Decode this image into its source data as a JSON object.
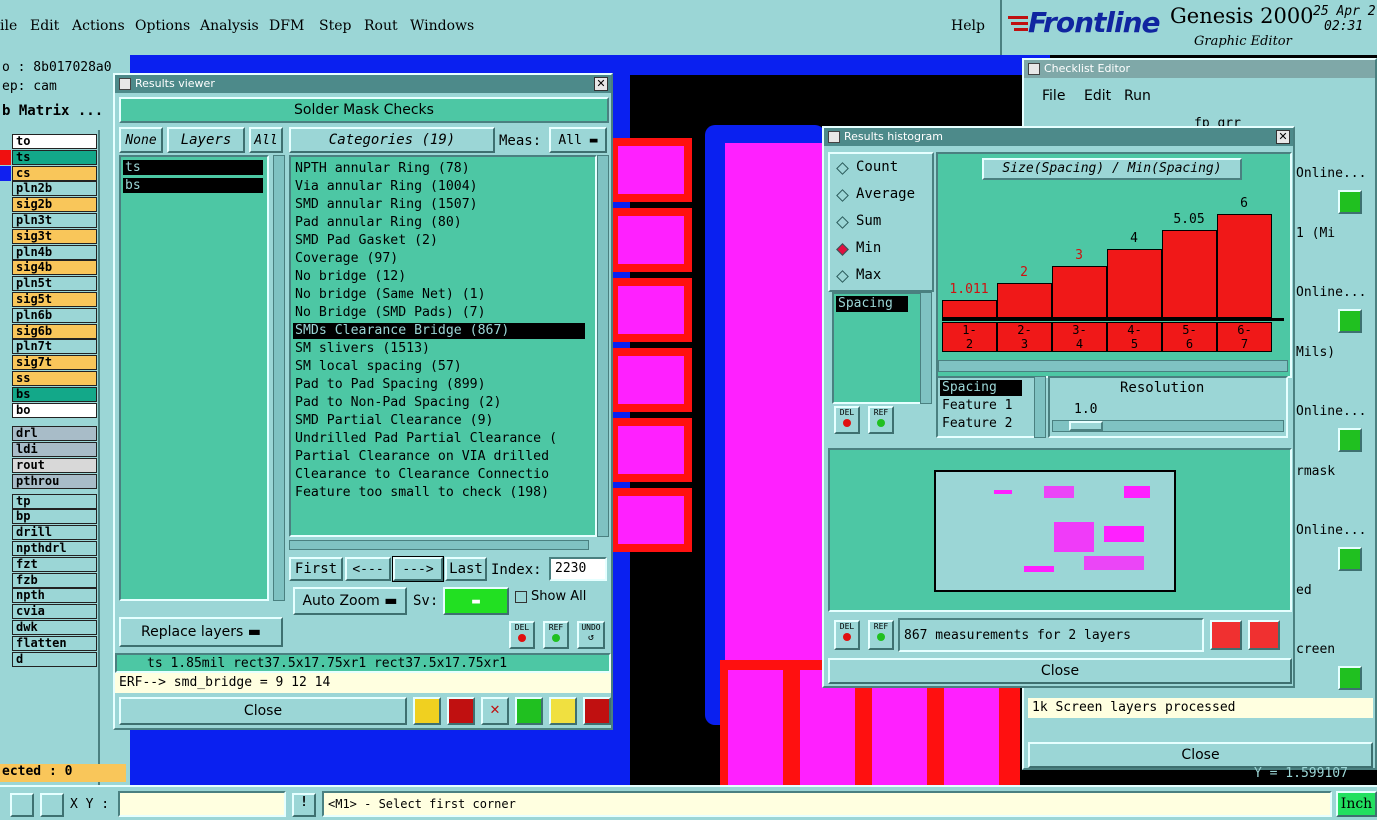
{
  "menubar": {
    "items": [
      "ile",
      "Edit",
      "Actions",
      "Options",
      "Analysis",
      "DFM",
      "Step",
      "Rout",
      "Windows"
    ],
    "help": "Help"
  },
  "brand": {
    "logo": "Frontline",
    "product": "Genesis 2000",
    "subtitle": "Graphic Editor",
    "date": "25 Apr 2",
    "time": "02:31"
  },
  "left_panel": {
    "job": "o : 8b017028a0",
    "step": "ep: cam",
    "matrix": "b Matrix ...",
    "layers": [
      {
        "name": "to",
        "color": "#ffffff"
      },
      {
        "name": "ts",
        "color": "#13a889"
      },
      {
        "name": "cs",
        "color": "#f9c65a"
      },
      {
        "name": "pln2b",
        "color": "#9bd6d6"
      },
      {
        "name": "sig2b",
        "color": "#f9c65a"
      },
      {
        "name": "pln3t",
        "color": "#9bd6d6"
      },
      {
        "name": "sig3t",
        "color": "#f9c65a"
      },
      {
        "name": "pln4b",
        "color": "#9bd6d6"
      },
      {
        "name": "sig4b",
        "color": "#f9c65a"
      },
      {
        "name": "pln5t",
        "color": "#9bd6d6"
      },
      {
        "name": "sig5t",
        "color": "#f9c65a"
      },
      {
        "name": "pln6b",
        "color": "#9bd6d6"
      },
      {
        "name": "sig6b",
        "color": "#f9c65a"
      },
      {
        "name": "pln7t",
        "color": "#9bd6d6"
      },
      {
        "name": "sig7t",
        "color": "#f9c65a"
      },
      {
        "name": "ss",
        "color": "#f9c65a"
      },
      {
        "name": "bs",
        "color": "#13a889"
      },
      {
        "name": "bo",
        "color": "#ffffff"
      }
    ],
    "drill_layers": [
      {
        "name": "drl",
        "color": "#a8bcc8"
      },
      {
        "name": "ldi",
        "color": "#a8bcc8"
      },
      {
        "name": "rout",
        "color": "#d8d8d8"
      },
      {
        "name": "pthrou",
        "color": "#a8bcc8"
      }
    ],
    "misc_layers": [
      {
        "name": "tp"
      },
      {
        "name": "bp"
      },
      {
        "name": "drill"
      },
      {
        "name": "npthdrl"
      },
      {
        "name": "fzt"
      },
      {
        "name": "fzb"
      },
      {
        "name": "npth"
      },
      {
        "name": "cvia"
      },
      {
        "name": "dwk"
      },
      {
        "name": "flatten"
      },
      {
        "name": "d"
      }
    ],
    "selected": "ected : 0"
  },
  "results_viewer": {
    "title": "Results viewer",
    "header": "Solder Mask Checks",
    "none": "None",
    "layers_tab": "Layers",
    "all": "All",
    "layer_items": [
      "ts",
      "bs"
    ],
    "categories_btn": "Categories (19)",
    "meas_label": "Meas:",
    "meas_value": "All",
    "categories": [
      "NPTH annular Ring (78)",
      "Via annular Ring (1004)",
      "SMD annular Ring (1507)",
      "Pad annular Ring (80)",
      "SMD Pad Gasket (2)",
      "Coverage (97)",
      "No bridge (12)",
      "No bridge (Same Net) (1)",
      "No Bridge (SMD Pads) (7)",
      "SMDs Clearance Bridge (867)",
      "SM slivers (1513)",
      "SM local spacing (57)",
      "Pad to Pad Spacing (899)",
      "Pad to Non-Pad Spacing (2)",
      "SMD Partial Clearance (9)",
      "Undrilled Pad Partial Clearance (",
      "Partial Clearance on VIA drilled",
      "Clearance to Clearance Connectio",
      "Feature too small to check (198)"
    ],
    "selected_index": 9,
    "first": "First",
    "prev": "<---",
    "next": "--->",
    "last": "Last",
    "index_label": "Index:",
    "index_value": "2230",
    "auto_zoom": "Auto Zoom",
    "sv_label": "Sv:",
    "show_all": "Show All",
    "replace_layers": "Replace layers",
    "del": "DEL",
    "ref": "REF",
    "undo": "UNDO",
    "status": "ts 1.85mil   rect37.5x17.75xr1   rect37.5x17.75xr1",
    "erf": "ERF--> smd_bridge = 9 12 14",
    "close": "Close"
  },
  "histogram": {
    "title": "Results histogram",
    "modes": [
      {
        "label": "Count",
        "selected": false
      },
      {
        "label": "Average",
        "selected": false
      },
      {
        "label": "Sum",
        "selected": false
      },
      {
        "label": "Min",
        "selected": true
      },
      {
        "label": "Max",
        "selected": false
      }
    ],
    "list_item": "Spacing",
    "chart_title": "Size(Spacing) / Min(Spacing)",
    "chart_data": {
      "type": "bar",
      "title": "Size(Spacing) / Min(Spacing)",
      "categories": [
        "1-\n2",
        "2-\n3",
        "3-\n4",
        "4-\n5",
        "5-\n6",
        "6-\n7"
      ],
      "values": [
        1.011,
        2,
        3,
        4,
        5.05,
        6
      ],
      "value_labels": [
        "1.011",
        "2",
        "3",
        "4",
        "5.05",
        "6"
      ],
      "ylim": [
        0,
        7
      ]
    },
    "fields": [
      "Spacing",
      "Feature 1",
      "Feature 2"
    ],
    "resolution_label": "Resolution",
    "resolution_value": "1.0",
    "measurements": "867 measurements for 2 layers",
    "close": "Close",
    "del": "DEL",
    "ref": "REF"
  },
  "checklist": {
    "title": "Checklist Editor",
    "menus": [
      "File",
      "Edit",
      "Run"
    ],
    "partial": "fp_grr",
    "rows": [
      "Online...",
      "1 (Mi",
      "Online...",
      "Mils)",
      "Online...",
      "rmask",
      "Online...",
      "ed",
      "creen",
      "Online..."
    ],
    "status": "1k Screen layers processed",
    "close": "Close",
    "coord": "Y = 1.599107"
  },
  "bottom": {
    "xy_label": "X Y :",
    "prompt": "<M1> - Select first corner",
    "units": "Inch"
  }
}
